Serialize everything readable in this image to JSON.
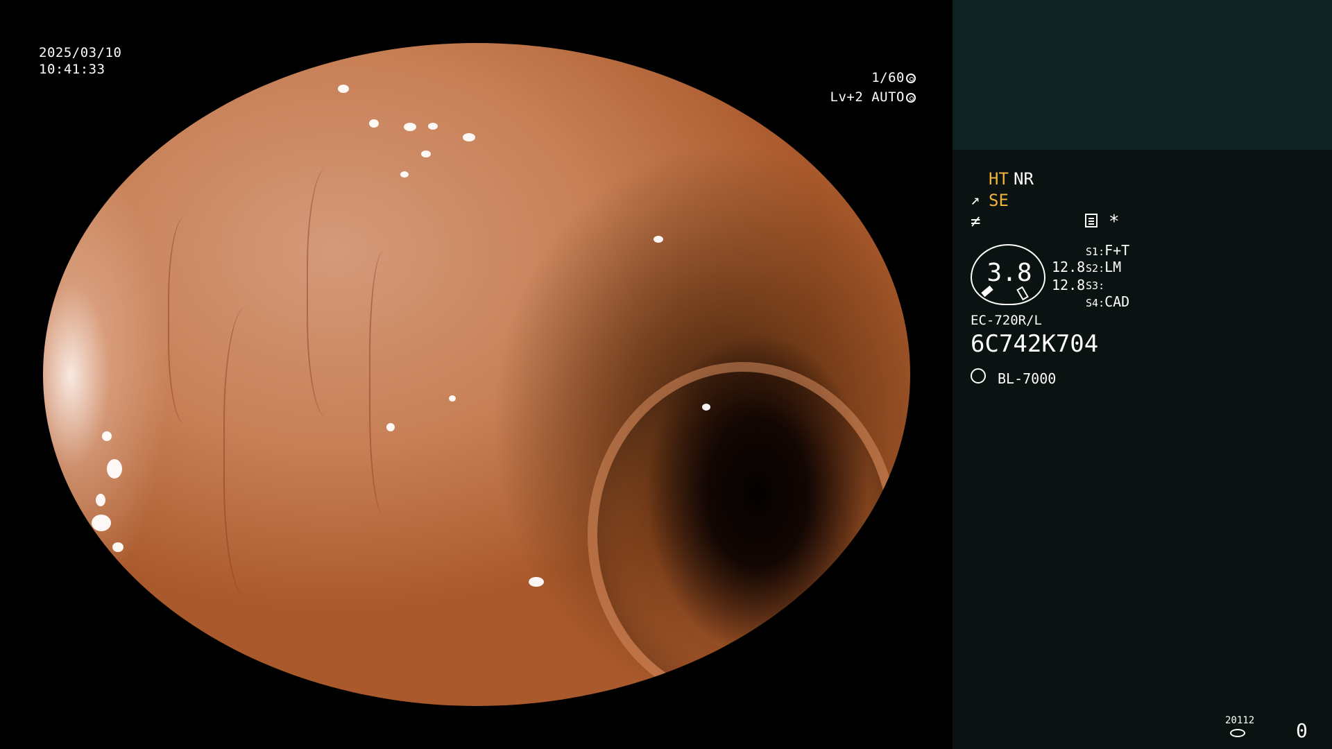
{
  "image_info": {
    "date": "2025/03/10",
    "time": "10:41:33",
    "shutter": "1/60",
    "iris_level": "Lv+2 AUTO"
  },
  "side_panel": {
    "enhancement": {
      "ht": "HT",
      "nr": "NR",
      "se": "SE"
    },
    "gauge": {
      "value": "3.8",
      "values": [
        "12.8",
        "12.8"
      ]
    },
    "switches": [
      {
        "slot": "S1",
        "label": "F+T"
      },
      {
        "slot": "S2",
        "label": "LM"
      },
      {
        "slot": "S3",
        "label": ""
      },
      {
        "slot": "S4",
        "label": "CAD"
      }
    ],
    "scope_model": "EC-720R/L",
    "serial": "6C742K704",
    "light_source": "BL-7000",
    "storage_count": "20112",
    "image_count": "0"
  },
  "colors": {
    "panel_bg": "#0a1212",
    "panel_top_bg": "#0e2224",
    "accent_orange": "#f0b23c"
  },
  "icons": [
    "shutter-icon",
    "iris-icon",
    "structure-enhance-icon",
    "color-icon",
    "memo-icon",
    "light-source-icon",
    "disk-icon"
  ]
}
